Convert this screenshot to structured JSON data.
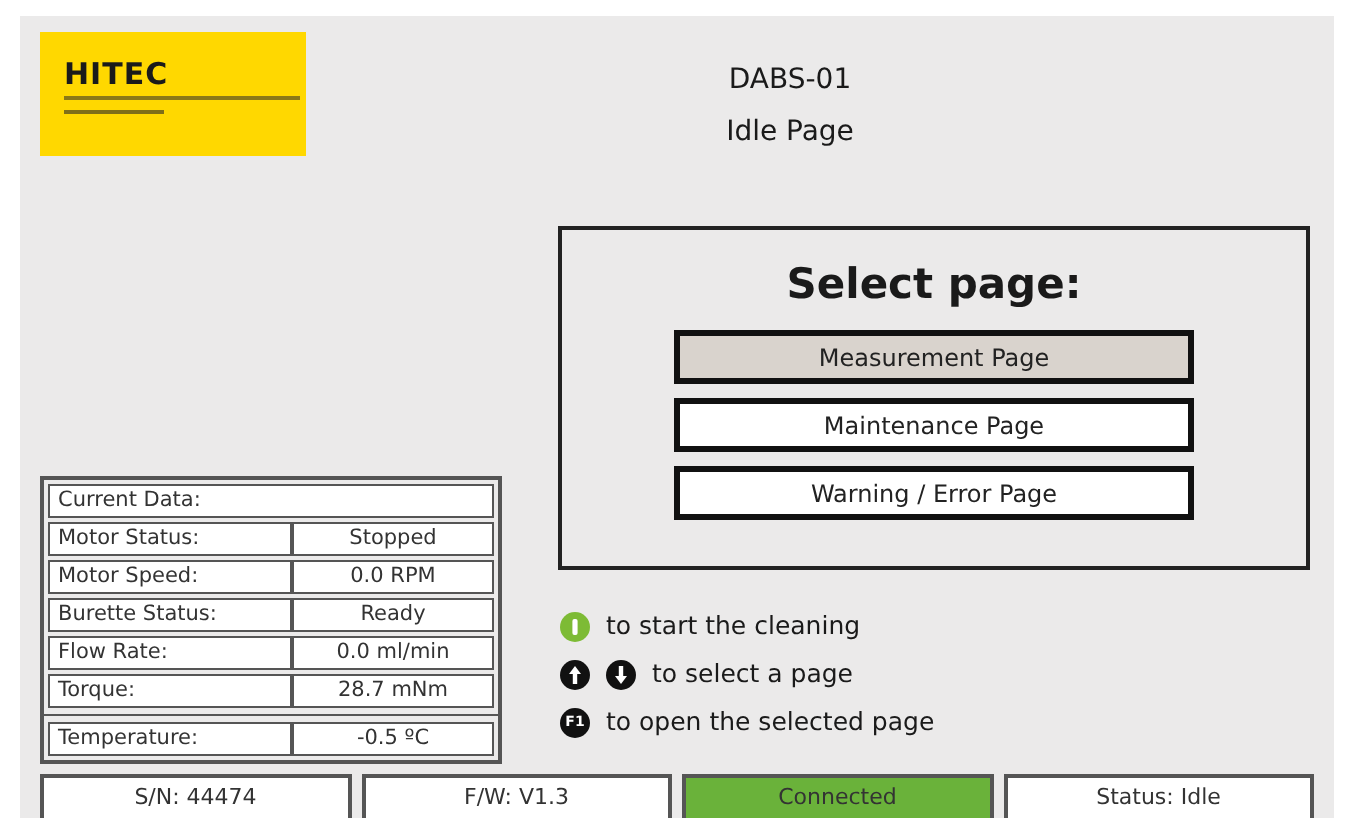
{
  "logo": {
    "name": "HITEC"
  },
  "header": {
    "device": "DABS-01",
    "page": "Idle Page"
  },
  "select_panel": {
    "title": "Select page:",
    "options": [
      {
        "label": "Measurement Page",
        "selected": true
      },
      {
        "label": "Maintenance Page",
        "selected": false
      },
      {
        "label": "Warning / Error Page",
        "selected": false
      }
    ]
  },
  "current_data": {
    "title": "Current Data:",
    "rows": [
      {
        "label": "Motor Status:",
        "value": "Stopped"
      },
      {
        "label": "Motor Speed:",
        "value": "0.0 RPM"
      },
      {
        "label": "Burette Status:",
        "value": "Ready"
      },
      {
        "label": "Flow Rate:",
        "value": "0.0 ml/min"
      },
      {
        "label": "Torque:",
        "value": "28.7 mNm"
      }
    ],
    "temperature": {
      "label": "Temperature:",
      "value": "-0.5 ºC"
    }
  },
  "legend": [
    {
      "keys": [
        {
          "kind": "start"
        }
      ],
      "text": "to start the cleaning"
    },
    {
      "keys": [
        {
          "kind": "up"
        },
        {
          "kind": "down"
        }
      ],
      "text": "to select a page"
    },
    {
      "keys": [
        {
          "kind": "fkey",
          "label": "F1"
        }
      ],
      "text": "to open the selected page"
    }
  ],
  "status_bar": [
    {
      "text": "S/N: 44474",
      "kind": "plain"
    },
    {
      "text": "F/W: V1.3",
      "kind": "plain"
    },
    {
      "text": "Connected",
      "kind": "connection",
      "on": true
    },
    {
      "text": "Status: Idle",
      "kind": "plain"
    }
  ]
}
